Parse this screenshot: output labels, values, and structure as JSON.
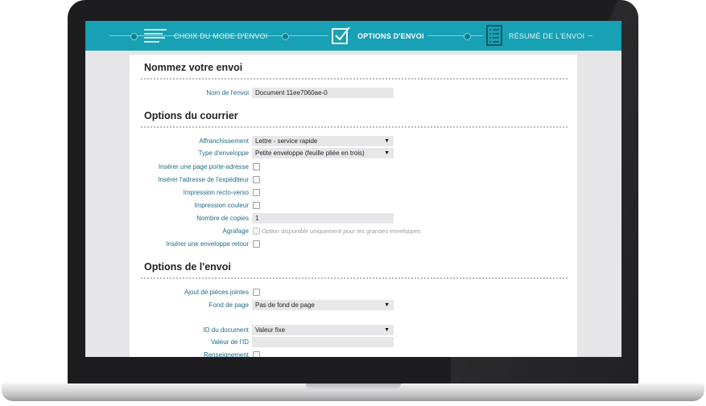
{
  "header": {
    "steps": [
      {
        "label": "CHOIX DU MODE D'ENVOI",
        "icon": "menu-lines-icon",
        "active": false
      },
      {
        "label": "OPTIONS D'ENVOI",
        "icon": "checkbox-checked-icon",
        "active": true
      },
      {
        "label": "RÉSUMÉ DE L'ENVOI",
        "icon": "checklist-document-icon",
        "active": false
      }
    ],
    "color": "#18a0b5"
  },
  "section_name": {
    "title": "Nommez votre envoi",
    "fields": {
      "name_label": "Nom de l'envoi",
      "name_value": "Document 11ee7060ae-0"
    }
  },
  "section_mail": {
    "title": "Options du courrier",
    "postage_label": "Affranchissement",
    "postage_value": "Lettre - service rapide",
    "envelope_label": "Type d'enveloppe",
    "envelope_value": "Petite enveloppe (feuille pliée en trois)",
    "insert_address_page": "Insérer une page porte-adresse",
    "insert_sender": "Insérer l'adresse de l'expéditeur",
    "duplex": "Impression recto-verso",
    "color_print": "Impression couleur",
    "copies_label": "Nombre de copies",
    "copies_value": "1",
    "stapling_label": "Agrafage",
    "stapling_hint": "Option disponible uniquement pour les grandes enveloppes",
    "return_envelope": "Insérer une enveloppe retour"
  },
  "section_send": {
    "title": "Options de l'envoi",
    "attachments": "Ajout de pièces jointes",
    "background_label": "Fond de page",
    "background_value": "Pas de fond de page",
    "docid_label": "ID du document",
    "docid_value": "Valeur fixe",
    "idvalue_label": "Valeur de l'ID",
    "idvalue_value": "",
    "cut_label": "Renseignement"
  }
}
